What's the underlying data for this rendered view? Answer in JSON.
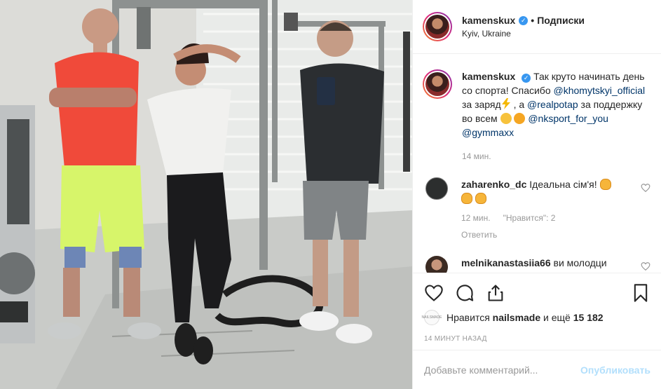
{
  "post": {
    "username": "kamenskux",
    "follow_label": "Подписки",
    "dot": "•",
    "location": "Kyiv, Ukraine"
  },
  "caption": {
    "username": "kamenskux",
    "text_1": "Так круто начинать день со спорта! Спасибо",
    "mention_1": "@khomytskyi_official",
    "text_2": "за заряд",
    "text_3": ", а",
    "mention_2": "@realpotap",
    "text_4": "за поддержку во всем",
    "mention_3": "@nksport_for_you",
    "mention_4": "@gymmaxx",
    "time": "14 мин."
  },
  "comments": [
    {
      "username": "zaharenko_dc",
      "text": "Ідеальна сім'я!",
      "time": "12 мин.",
      "likes": "\"Нравится\": 2",
      "reply": "Ответить"
    },
    {
      "username": "melnikanastasiia66",
      "text": "ви молодци"
    }
  ],
  "likes": {
    "prefix": "Нравится",
    "user": "nailsmade",
    "suffix": "и ещё",
    "count": "15 182",
    "avatar_text": "NAILSMADE"
  },
  "timestamp": "14 минут назад",
  "add_comment": {
    "placeholder": "Добавьте комментарий...",
    "publish_label": "Опубликовать"
  },
  "colors": {
    "verified": "#3897f0",
    "mention": "#003569",
    "publish_disabled": "#b2dffc"
  },
  "icons": [
    "heart-icon",
    "comment-icon",
    "share-icon",
    "bookmark-icon",
    "verified-badge-icon"
  ]
}
